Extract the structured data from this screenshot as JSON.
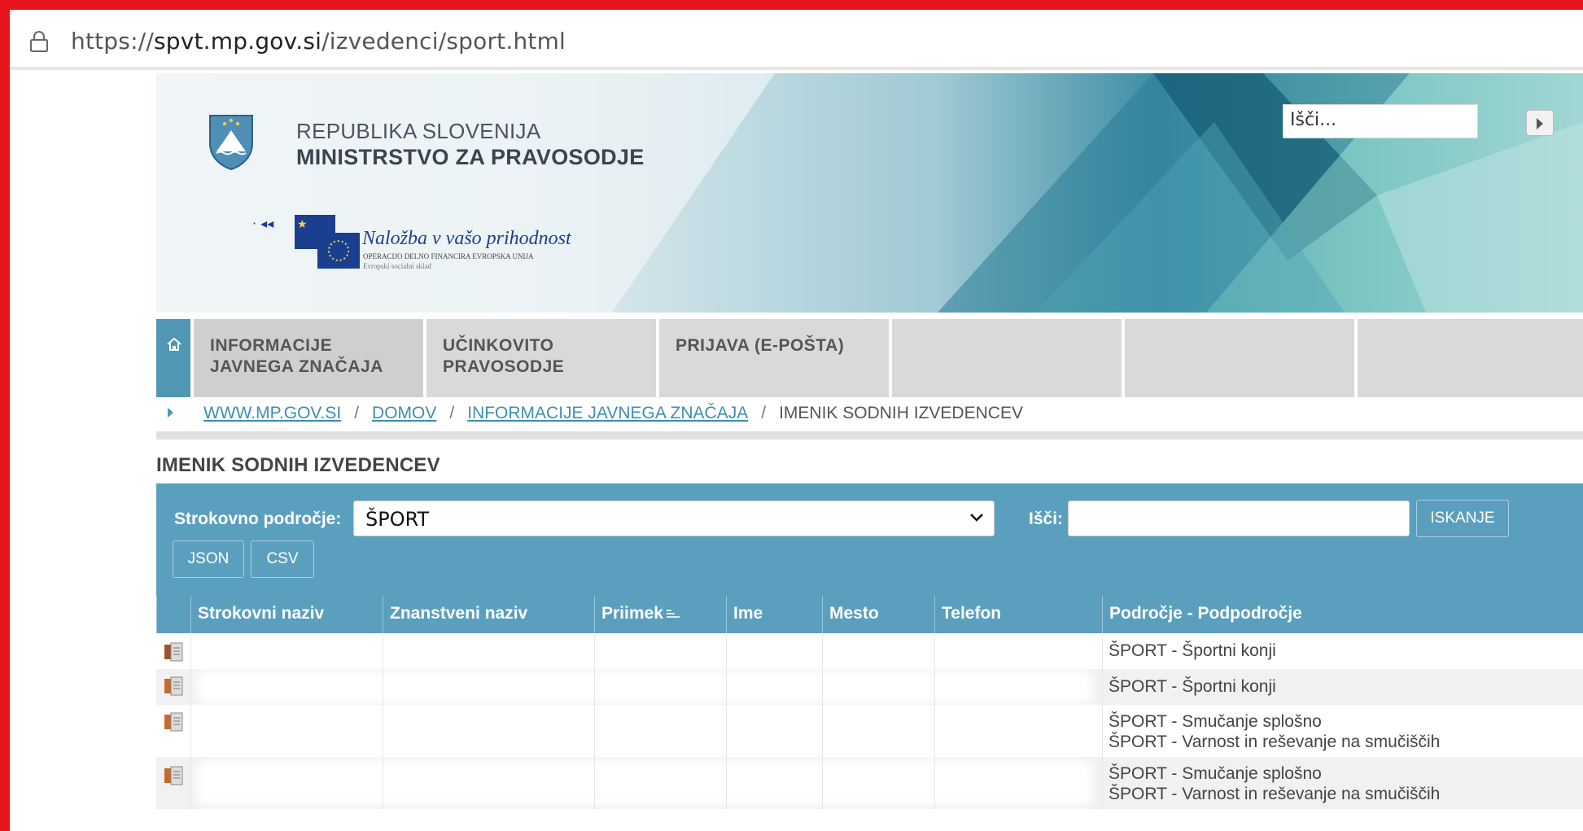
{
  "browser": {
    "url_scheme": "https://",
    "url_host": "spvt.mp.gov.si",
    "url_path": "/izvedenci/sport.html"
  },
  "header": {
    "gov_line1": "REPUBLIKA SLOVENIJA",
    "gov_line2": "MINISTRSTVO ZA PRAVOSODJE",
    "eu_slogan": "Naložba v vašo prihodnost",
    "eu_sub1": "OPERACIJO DELNO FINANCIRA EVROPSKA UNIJA",
    "eu_sub2": "Evropski socialni sklad",
    "search_placeholder": "Išči..."
  },
  "nav": {
    "items": [
      {
        "line1": "INFORMACIJE",
        "line2": "JAVNEGA ZNAČAJA"
      },
      {
        "line1": "UČINKOVITO",
        "line2": "PRAVOSODJE"
      },
      {
        "line1": "PRIJAVA (E-POŠTA)",
        "line2": ""
      },
      {
        "line1": "",
        "line2": ""
      },
      {
        "line1": "",
        "line2": ""
      },
      {
        "line1": "",
        "line2": ""
      }
    ]
  },
  "breadcrumb": {
    "items": [
      "WWW.MP.GOV.SI",
      "DOMOV",
      "INFORMACIJE JAVNEGA ZNAČAJA"
    ],
    "separator": "/",
    "current": "IMENIK SODNIH IZVEDENCEV"
  },
  "section_title": "IMENIK SODNIH IZVEDENCEV",
  "filter": {
    "field_label": "Strokovno področje:",
    "field_value": "ŠPORT",
    "search_label": "Išči:",
    "search_value": "",
    "search_button": "ISKANJE",
    "json_button": "JSON",
    "csv_button": "CSV"
  },
  "table": {
    "columns": [
      "Strokovni naziv",
      "Znanstveni naziv",
      "Priimek",
      "Ime",
      "Mesto",
      "Telefon",
      "Področje - Podpodročje"
    ],
    "rows": [
      {
        "area": [
          "ŠPORT - Športni konji"
        ]
      },
      {
        "area": [
          "ŠPORT - Športni konji"
        ]
      },
      {
        "area": [
          "ŠPORT - Smučanje splošno",
          "ŠPORT - Varnost in reševanje na smučiščih"
        ]
      },
      {
        "area": [
          "ŠPORT - Smučanje splošno",
          "ŠPORT - Varnost in reševanje na smučiščih"
        ]
      }
    ]
  },
  "colors": {
    "frame": "#e8141b",
    "accent_blue": "#5b9fbe",
    "link_blue": "#3d8eb0",
    "nav_grey": "#d9d9d9"
  }
}
